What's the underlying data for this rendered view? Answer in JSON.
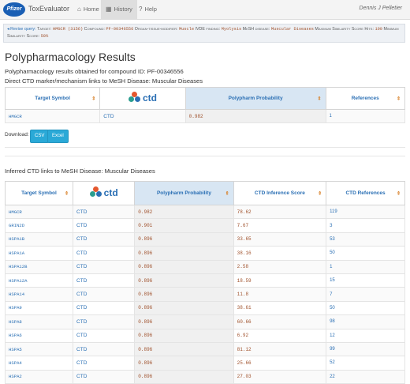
{
  "navbar": {
    "logo": "Pfizer",
    "brand": "ToxEvaluator",
    "items": [
      {
        "icon": "home-icon",
        "glyph": "⌂",
        "label": "Home"
      },
      {
        "icon": "history-icon",
        "glyph": "▦",
        "label": "History"
      },
      {
        "icon": "help-icon",
        "glyph": "?",
        "label": "Help"
      }
    ],
    "user": "Dennis J Pelletier"
  },
  "query": {
    "revise": "Revise query:",
    "parts": [
      {
        "k": "Target:",
        "v": "HMGCR (3156)"
      },
      {
        "k": "Compound:",
        "v": "PF-00346556"
      },
      {
        "k": "Organ-tissue-modifier:",
        "v": "Muscle"
      },
      {
        "k": "IVDE finding:",
        "v": "Myolysis"
      },
      {
        "k": "MeSH disease:",
        "v": "Muscular Diseases"
      },
      {
        "k": "Maximum Similarity Score Hits:",
        "v": "100"
      },
      {
        "k": "Minimum Similarity Score:",
        "v": "50%"
      }
    ]
  },
  "page": {
    "title": "Polypharmacology Results",
    "subtitle": "Polypharmacology results obtained for compound ID: PF-00346556",
    "direct_heading": "Direct CTD marker/mechanism links to MeSH Disease: Muscular Diseases",
    "download_label": "Download:",
    "csv": "CSV",
    "excel": "Excel",
    "inferred_heading": "Inferred CTD links to MeSH Disease: Muscular Diseases"
  },
  "direct_table": {
    "headers": {
      "symbol": "Target Symbol",
      "logo": "ctd",
      "prob": "Polypharm Probability",
      "refs": "References"
    },
    "rows": [
      {
        "symbol": "HMGCR",
        "src": "CTD",
        "prob": "0.982",
        "refs": "1"
      }
    ]
  },
  "inferred_table": {
    "headers": {
      "symbol": "Target Symbol",
      "logo": "ctd",
      "prob": "Polypharm Probability",
      "score": "CTD Inference Score",
      "refs": "CTD References"
    },
    "rows": [
      {
        "symbol": "HMGCR",
        "src": "CTD",
        "prob": "0.982",
        "score": "78.62",
        "refs": "119"
      },
      {
        "symbol": "GRIN2D",
        "src": "CTD",
        "prob": "0.901",
        "score": "7.67",
        "refs": "3"
      },
      {
        "symbol": "HSPA1B",
        "src": "CTD",
        "prob": "0.896",
        "score": "33.65",
        "refs": "53"
      },
      {
        "symbol": "HSPA1A",
        "src": "CTD",
        "prob": "0.896",
        "score": "38.16",
        "refs": "50"
      },
      {
        "symbol": "HSPA12B",
        "src": "CTD",
        "prob": "0.896",
        "score": "2.58",
        "refs": "1"
      },
      {
        "symbol": "HSPA12A",
        "src": "CTD",
        "prob": "0.896",
        "score": "18.59",
        "refs": "15"
      },
      {
        "symbol": "HSPA14",
        "src": "CTD",
        "prob": "0.896",
        "score": "11.8",
        "refs": "7"
      },
      {
        "symbol": "HSPA9",
        "src": "CTD",
        "prob": "0.896",
        "score": "38.61",
        "refs": "50"
      },
      {
        "symbol": "HSPA8",
        "src": "CTD",
        "prob": "0.896",
        "score": "60.66",
        "refs": "98"
      },
      {
        "symbol": "HSPA6",
        "src": "CTD",
        "prob": "0.896",
        "score": "6.92",
        "refs": "12"
      },
      {
        "symbol": "HSPA5",
        "src": "CTD",
        "prob": "0.896",
        "score": "81.12",
        "refs": "99"
      },
      {
        "symbol": "HSPA4",
        "src": "CTD",
        "prob": "0.896",
        "score": "25.66",
        "refs": "52"
      },
      {
        "symbol": "HSPA2",
        "src": "CTD",
        "prob": "0.896",
        "score": "27.03",
        "refs": "22"
      }
    ]
  }
}
